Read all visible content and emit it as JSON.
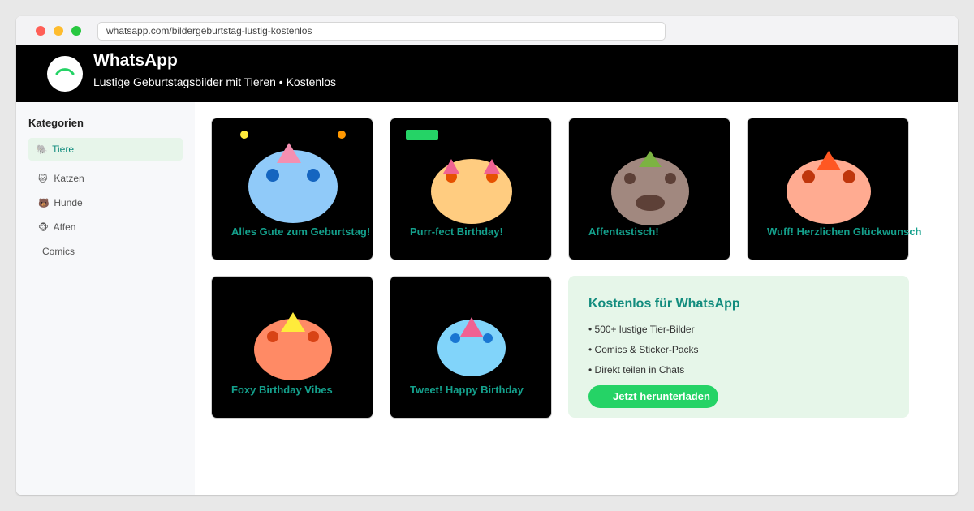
{
  "browser": {
    "url": "whatsapp.com/bildergeburtstag-lustig-kostenlos"
  },
  "header": {
    "title": "WhatsApp",
    "subtitle": "Lustige Geburtstagsbilder mit Tieren • Kostenlos",
    "logo_icon": "whatsapp-logo-icon",
    "brand_color": "#25d366"
  },
  "sidebar": {
    "heading": "Kategorien",
    "items": [
      {
        "icon": "🐘",
        "icon_name": "animal-icon",
        "label": "Tiere",
        "active": true
      },
      {
        "icon": "🐱",
        "icon_name": "cat-icon",
        "label": "Katzen",
        "active": false
      },
      {
        "icon": "🐻",
        "icon_name": "dog-icon",
        "label": "Hunde",
        "active": false
      },
      {
        "icon": "🐵",
        "icon_name": "monkey-icon",
        "label": "Affen",
        "active": false
      },
      {
        "icon": "",
        "icon_name": "",
        "label": "Comics",
        "active": false
      }
    ]
  },
  "cards": [
    {
      "caption": "Alles Gute zum Geburtstag!",
      "face_color": "#90caf9",
      "eye_color": "#1565c0",
      "hat_color": "#f48fb1"
    },
    {
      "caption": "Purr-fect Birthday!",
      "face_color": "#ffcc80",
      "eye_color": "#e65100",
      "ear_color": "#f06292"
    },
    {
      "caption": "Affentastisch!",
      "face_color": "#a1887f",
      "eye_color": "#5d4037",
      "hat_color": "#7cb342"
    },
    {
      "caption": "Wuff! Herzlichen Glückwunsch",
      "face_color": "#ffab91",
      "eye_color": "#bf360c",
      "hat_color": "#ff5722"
    },
    {
      "caption": "Foxy Birthday Vibes",
      "face_color": "#ff8a65",
      "eye_color": "#d84315",
      "hat_color": "#ffeb3b"
    },
    {
      "caption": "Tweet! Happy Birthday",
      "face_color": "#81d4fa",
      "eye_color": "#1976d2",
      "hat_color": "#f06292"
    }
  ],
  "promo": {
    "title": "Kostenlos für WhatsApp",
    "features": [
      "• 500+ lustige Tier-Bilder",
      "• Comics & Sticker-Packs",
      "• Direkt teilen in Chats"
    ],
    "button_label": "Jetzt herunterladen"
  }
}
